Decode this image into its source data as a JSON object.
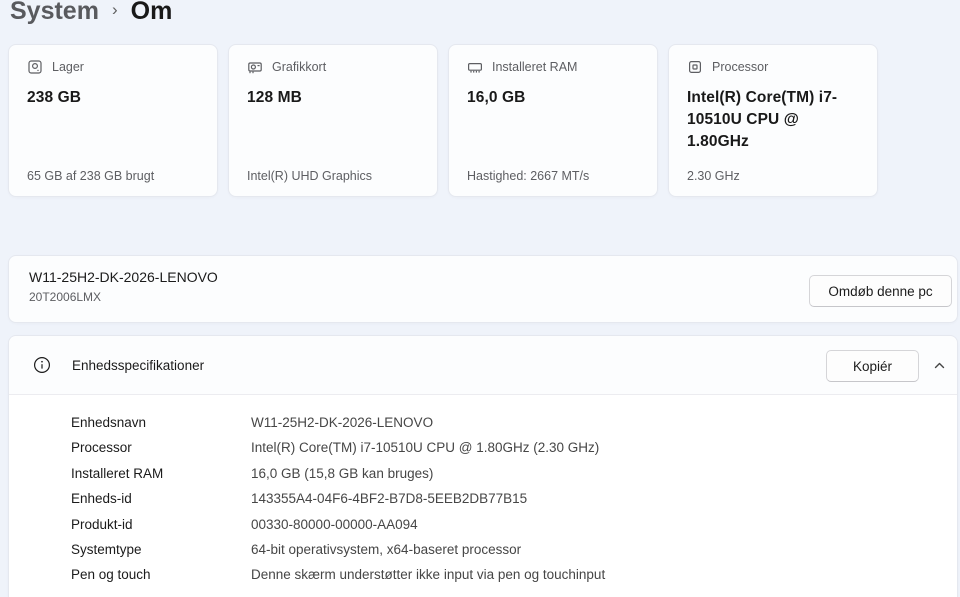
{
  "breadcrumb": {
    "parent": "System",
    "separator": "›",
    "current": "Om"
  },
  "cards": [
    {
      "icon": "storage-icon",
      "label": "Lager",
      "value": "238 GB",
      "caption": "65 GB af 238 GB brugt"
    },
    {
      "icon": "gpu-icon",
      "label": "Grafikkort",
      "value": "128 MB",
      "caption": "Intel(R) UHD Graphics"
    },
    {
      "icon": "ram-icon",
      "label": "Installeret RAM",
      "value": "16,0 GB",
      "caption": "Hastighed: 2667 MT/s"
    },
    {
      "icon": "cpu-icon",
      "label": "Processor",
      "value": "Intel(R) Core(TM) i7-10510U CPU @ 1.80GHz",
      "caption": "2.30 GHz"
    }
  ],
  "device": {
    "name": "W11-25H2-DK-2026-LENOVO",
    "model": "20T2006LMX",
    "rename_button_label": "Omdøb denne pc"
  },
  "specs": {
    "title": "Enhedsspecifikationer",
    "copy_button_label": "Kopiér",
    "rows": [
      {
        "label": "Enhedsnavn",
        "value": "W11-25H2-DK-2026-LENOVO"
      },
      {
        "label": "Processor",
        "value": "Intel(R) Core(TM) i7-10510U CPU @ 1.80GHz (2.30 GHz)"
      },
      {
        "label": "Installeret RAM",
        "value": "16,0 GB (15,8 GB kan bruges)"
      },
      {
        "label": "Enheds-id",
        "value": "143355A4-04F6-4BF2-B7D8-5EEB2DB77B15"
      },
      {
        "label": "Produkt-id",
        "value": "00330-80000-00000-AA094"
      },
      {
        "label": "Systemtype",
        "value": "64-bit operativsystem, x64-baseret processor"
      },
      {
        "label": "Pen og touch",
        "value": "Denne skærm understøtter ikke input via pen og touchinput"
      }
    ]
  },
  "colors": {
    "page_background": "#eff3fa",
    "card_background": "#fcfdfe",
    "card_border": "#e5e8ef",
    "text_primary": "#1b1b1b",
    "text_secondary": "#5d5e62"
  }
}
